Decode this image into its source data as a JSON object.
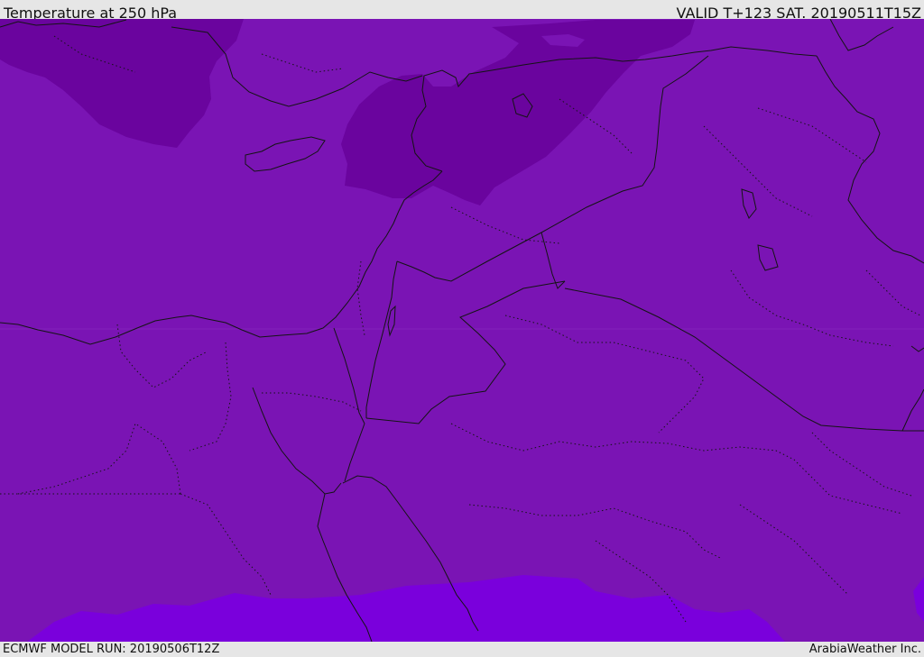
{
  "header": {
    "title": "Temperature at 250 hPa",
    "valid": "VALID T+123 SAT. 20190511T15Z"
  },
  "footer": {
    "model_run": "ECMWF MODEL RUN: 20190506T12Z",
    "credit": "ArabiaWeather Inc."
  },
  "map": {
    "colors": {
      "base_field": "#7a14b4",
      "cold_region": "#6a049e",
      "warm_region": "#7a00dc",
      "boundary_line": "#141414",
      "header_bg": "#e6e6e6"
    }
  }
}
